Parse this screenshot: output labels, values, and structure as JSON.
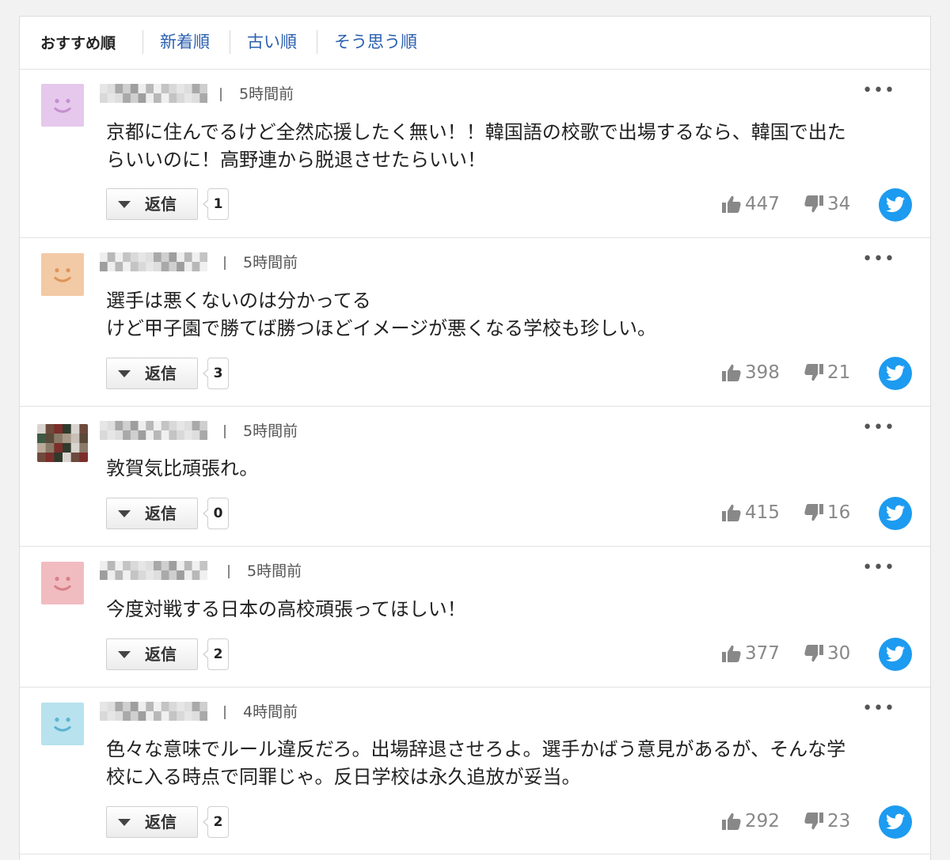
{
  "sort_tabs": [
    {
      "label": "おすすめ順",
      "active": true
    },
    {
      "label": "新着順",
      "active": false
    },
    {
      "label": "古い順",
      "active": false
    },
    {
      "label": "そう思う順",
      "active": false
    }
  ],
  "reply_label": "返信",
  "more_label": "•••",
  "colors": {
    "link": "#2a5fae",
    "twitter": "#1d9bf0",
    "vote_gray": "#888888"
  },
  "comments": [
    {
      "avatar": "smiley-purple",
      "avatar_color": "#e6c8ec",
      "avatar_face": "#c58fd0",
      "time": "5時間前",
      "lines": [
        "京都に住んでるけど全然応援したく無い！！韓国語の校歌で出場するなら、韓国で出た",
        "らいいのに！高野連から脱退させたらいい！"
      ],
      "reply_count": "1",
      "likes": "447",
      "dislikes": "34"
    },
    {
      "avatar": "smiley-orange",
      "avatar_color": "#f2caa6",
      "avatar_face": "#de955a",
      "time": "5時間前",
      "lines": [
        "選手は悪くないのは分かってる",
        "けど甲子園で勝てば勝つほどイメージが悪くなる学校も珍しい。"
      ],
      "reply_count": "3",
      "likes": "398",
      "dislikes": "21"
    },
    {
      "avatar": "blurred-photo",
      "avatar_color": "#6b5a4a",
      "avatar_face": "",
      "time": "5時間前",
      "lines": [
        "敦賀気比頑張れ。"
      ],
      "reply_count": "0",
      "likes": "415",
      "dislikes": "16"
    },
    {
      "avatar": "smiley-pink",
      "avatar_color": "#f1bcc0",
      "avatar_face": "#d98088",
      "time": "5時間前",
      "lines": [
        "今度対戦する日本の高校頑張ってほしい！"
      ],
      "reply_count": "2",
      "likes": "377",
      "dislikes": "30"
    },
    {
      "avatar": "smiley-blue",
      "avatar_color": "#b8e2ee",
      "avatar_face": "#5bb3d2",
      "time": "4時間前",
      "lines": [
        "色々な意味でルール違反だろ。出場辞退させろよ。選手かばう意見があるが、そんな学",
        "校に入る時点で同罪じゃ。反日学校は永久追放が妥当。"
      ],
      "reply_count": "2",
      "likes": "292",
      "dislikes": "23"
    }
  ]
}
